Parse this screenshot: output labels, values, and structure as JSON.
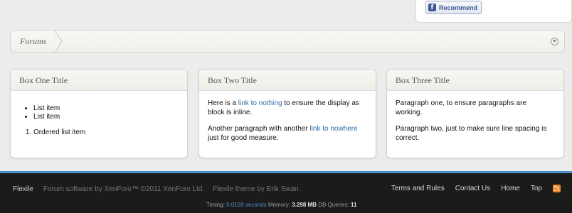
{
  "recommend": {
    "label": "Recommend",
    "icon": "facebook-icon"
  },
  "breadcrumb": {
    "items": [
      {
        "label": "Forums"
      }
    ],
    "jump_icon": "chevron-down-circle-icon"
  },
  "boxes": [
    {
      "title": "Box One Title",
      "bullets": [
        "List item",
        "List item"
      ],
      "ordered": [
        "Ordered list item"
      ]
    },
    {
      "title": "Box Two Title",
      "p1_before": "Here is a ",
      "p1_link": "link to nothing",
      "p1_after": " to ensure the display as block is inline.",
      "p2_before": "Another paragraph with another ",
      "p2_link": "link to nowhere",
      "p2_after": " just for good measure."
    },
    {
      "title": "Box Three Title",
      "p1": "Paragraph one, to ensure paragraphs are working.",
      "p2": "Paragraph two, just to make sure line spacing is correct."
    }
  ],
  "footer": {
    "brand": "Flexile",
    "copyright": "Forum software by XenForo™ ©2011 XenForo Ltd.",
    "theme_credit": "Flexile theme by Erik Swan.",
    "links": [
      "Terms and Rules",
      "Contact Us",
      "Home",
      "Top"
    ],
    "rss_icon": "rss-icon",
    "debug": {
      "timing_label": "Timing:",
      "timing_value": "0.0169 seconds",
      "memory_label": "Memory:",
      "memory_value": "3.298 MB",
      "queries_label": "DB Queries:",
      "queries_value": "11"
    }
  },
  "colors": {
    "accent": "#4d8fc9",
    "link": "#2d6ba6",
    "footer_bg": "#1b1b1b",
    "page_bg": "#ececec"
  }
}
